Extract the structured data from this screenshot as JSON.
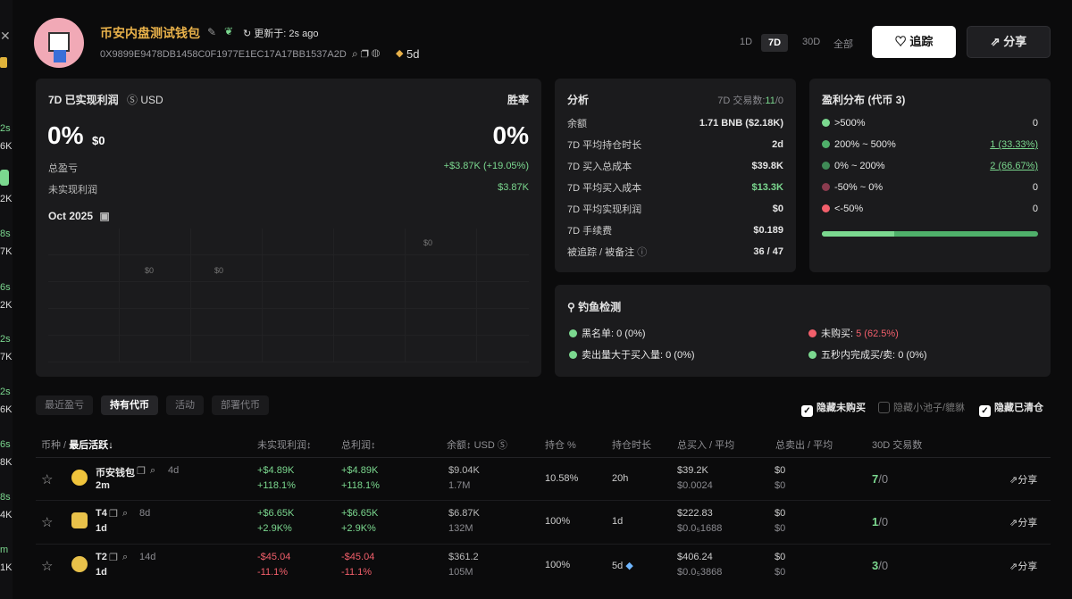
{
  "header": {
    "name": "币安内盘测试钱包",
    "updated_label": "更新于:",
    "updated_value": "2s ago",
    "address": "0X9899E9478DB1458C0F1977E1EC17A17BB1537A2D",
    "age": "5d"
  },
  "periods": [
    "1D",
    "7D",
    "30D",
    "全部"
  ],
  "buttons": {
    "follow": "追踪",
    "share": "分享"
  },
  "left_strip": [
    "2s",
    "6K",
    "2K",
    "8s",
    "7K",
    "6s",
    "2K",
    "2s",
    "7K",
    "2s",
    "6K",
    "6s",
    "8K",
    "8s",
    "4K",
    "m",
    "1K"
  ],
  "pnl": {
    "title": "7D 已实现利润",
    "currency": "USD",
    "winrate_label": "胜率",
    "pct": "0%",
    "amount": "$0",
    "winrate": "0%",
    "total_label": "总盈亏",
    "total_value": "+$3.87K (+19.05%)",
    "unreal_label": "未实现利润",
    "unreal_value": "$3.87K",
    "month": "Oct 2025",
    "bar_labels": [
      "$0",
      "$0",
      "$0"
    ]
  },
  "analysis": {
    "title": "分析",
    "tx_label": "7D 交易数:",
    "tx_buy": "11",
    "tx_sell": "/0",
    "rows": [
      {
        "label": "余额",
        "value": "1.71 BNB ($2.18K)"
      },
      {
        "label": "7D 平均持仓时长",
        "value": "2d"
      },
      {
        "label": "7D 买入总成本",
        "value": "$39.8K"
      },
      {
        "label": "7D 平均买入成本",
        "value": "$13.3K"
      },
      {
        "label": "7D 平均实现利润",
        "value": "$0"
      },
      {
        "label": "7D 手续费",
        "value": "$0.189"
      },
      {
        "label": "被追踪 / 被备注",
        "value": "36 / 47"
      }
    ]
  },
  "distribution": {
    "title": "盈利分布 (代币 3)",
    "rows": [
      {
        "label": ">500%",
        "value": "0",
        "color": "#7bd88f"
      },
      {
        "label": "200% ~ 500%",
        "value": "1 (33.33%)",
        "color": "#4fb06a"
      },
      {
        "label": "0% ~ 200%",
        "value": "2 (66.67%)",
        "color": "#3f8a56"
      },
      {
        "label": "-50% ~ 0%",
        "value": "0",
        "color": "#8a3b4e"
      },
      {
        "label": "<-50%",
        "value": "0",
        "color": "#f25f6b"
      }
    ],
    "bar_fill": 0.333
  },
  "phishing": {
    "title": "钓鱼检测",
    "items": [
      {
        "label": "黑名单:",
        "value": "0 (0%)",
        "color": "#7bd88f"
      },
      {
        "label": "未购买:",
        "value": "5 (62.5%)",
        "color": "#f25f6b"
      },
      {
        "label": "卖出量大于买入量:",
        "value": "0 (0%)",
        "color": "#7bd88f"
      },
      {
        "label": "五秒内完成买/卖:",
        "value": "0 (0%)",
        "color": "#7bd88f"
      }
    ]
  },
  "tabs": [
    "最近盈亏",
    "持有代币",
    "活动",
    "部署代币"
  ],
  "filters": [
    "隐藏未购买",
    "隐藏小池子/貔貅",
    "隐藏已清仓"
  ],
  "columns": [
    "币种 /",
    "最后活跃",
    "未实现利润",
    "总利润",
    "余额",
    "USD",
    "持仓 %",
    "持仓时长",
    "总买入 / 平均",
    "总卖出 / 平均",
    "30D 交易数"
  ],
  "rows": [
    {
      "token": "币安钱包",
      "age": "4d",
      "active": "2m",
      "unreal": "+$4.89K",
      "unreal_pct": "+118.1%",
      "total": "+$4.89K",
      "total_pct": "+118.1%",
      "bal": "$9.04K",
      "bal_amt": "1.7M",
      "hold": "10.58%",
      "dur": "20h",
      "buy": "$39.2K",
      "buy_avg": "$0.0024",
      "sell": "$0",
      "sell_avg": "$0",
      "tx_buy": "7",
      "tx_sell": "/0",
      "share": "分享"
    },
    {
      "token": "T4",
      "age": "8d",
      "active": "1d",
      "unreal": "+$6.65K",
      "unreal_pct": "+2.9K%",
      "total": "+$6.65K",
      "total_pct": "+2.9K%",
      "bal": "$6.87K",
      "bal_amt": "132M",
      "hold": "100%",
      "dur": "1d",
      "buy": "$222.83",
      "buy_avg": "$0.0₅1688",
      "sell": "$0",
      "sell_avg": "$0",
      "tx_buy": "1",
      "tx_sell": "/0",
      "share": "分享"
    },
    {
      "token": "T2",
      "age": "14d",
      "active": "1d",
      "unreal": "-$45.04",
      "unreal_pct": "-11.1%",
      "total": "-$45.04",
      "total_pct": "-11.1%",
      "bal": "$361.2",
      "bal_amt": "105M",
      "hold": "100%",
      "dur": "5d",
      "buy": "$406.24",
      "buy_avg": "$0.0₅3868",
      "sell": "$0",
      "sell_avg": "$0",
      "tx_buy": "3",
      "tx_sell": "/0",
      "share": "分享"
    }
  ]
}
